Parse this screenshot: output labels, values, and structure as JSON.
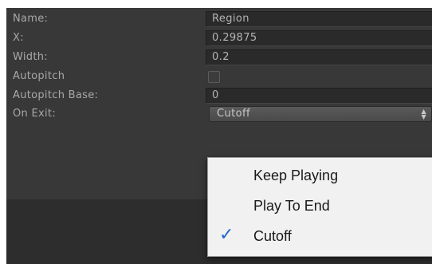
{
  "inspector": {
    "rows": [
      {
        "label": "Name:",
        "value": "Region",
        "type": "text"
      },
      {
        "label": "X:",
        "value": "0.29875",
        "type": "text"
      },
      {
        "label": "Width:",
        "value": "0.2",
        "type": "text"
      },
      {
        "label": "Autopitch",
        "checked": false,
        "type": "checkbox"
      },
      {
        "label": "Autopitch Base:",
        "value": "0",
        "type": "text"
      },
      {
        "label": "On Exit:",
        "value": "Cutoff",
        "type": "select"
      }
    ]
  },
  "dropdown": {
    "options": [
      {
        "label": "Keep Playing",
        "selected": false
      },
      {
        "label": "Play To End",
        "selected": false
      },
      {
        "label": "Cutoff",
        "selected": true
      }
    ],
    "check_glyph": "✓",
    "check_color": "#2266cc"
  },
  "select_arrows": "⬍"
}
